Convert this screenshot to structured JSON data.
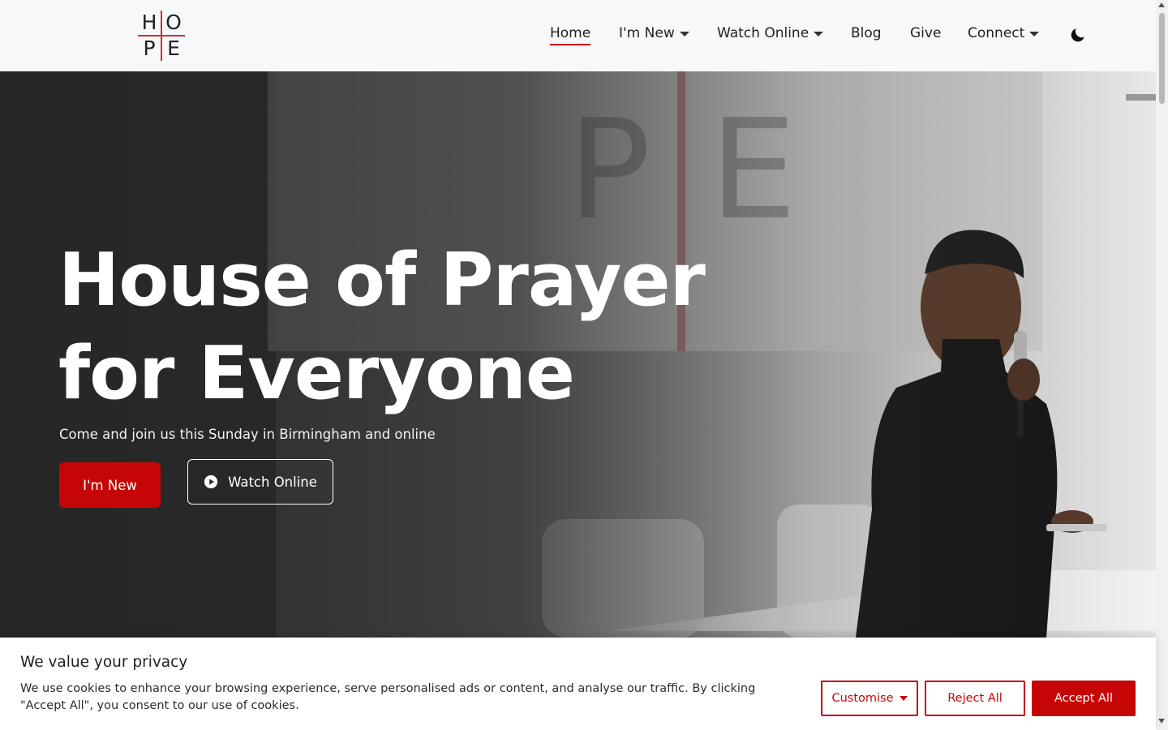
{
  "logo": {
    "letters": [
      "H",
      "O",
      "P",
      "E"
    ]
  },
  "nav": {
    "items": [
      {
        "label": "Home",
        "active": true,
        "dropdown": false
      },
      {
        "label": "I'm New",
        "active": false,
        "dropdown": true
      },
      {
        "label": "Watch Online",
        "active": false,
        "dropdown": true
      },
      {
        "label": "Blog",
        "active": false,
        "dropdown": false
      },
      {
        "label": "Give",
        "active": false,
        "dropdown": false
      },
      {
        "label": "Connect",
        "active": false,
        "dropdown": true
      }
    ],
    "theme_toggle_icon": "moon-icon"
  },
  "hero": {
    "title_line1": "House of Prayer",
    "title_line2": "for Everyone",
    "subtitle": "Come and join us this Sunday in Birmingham and online",
    "primary_button": "I'm New",
    "secondary_button": "Watch Online",
    "secondary_button_icon": "play-circle-icon",
    "background_image_letters": "P E"
  },
  "cookie_banner": {
    "title": "We value your privacy",
    "text": "We use cookies to enhance your browsing experience, serve personalised ads or content, and analyse our traffic. By clicking \"Accept All\", you consent to our use of cookies.",
    "customise_label": "Customise",
    "reject_label": "Reject All",
    "accept_label": "Accept All"
  },
  "colors": {
    "brand_red": "#c60606",
    "logo_red": "#d0302a",
    "header_bg": "#f7f8fa",
    "text_dark": "#1f1f1f"
  }
}
